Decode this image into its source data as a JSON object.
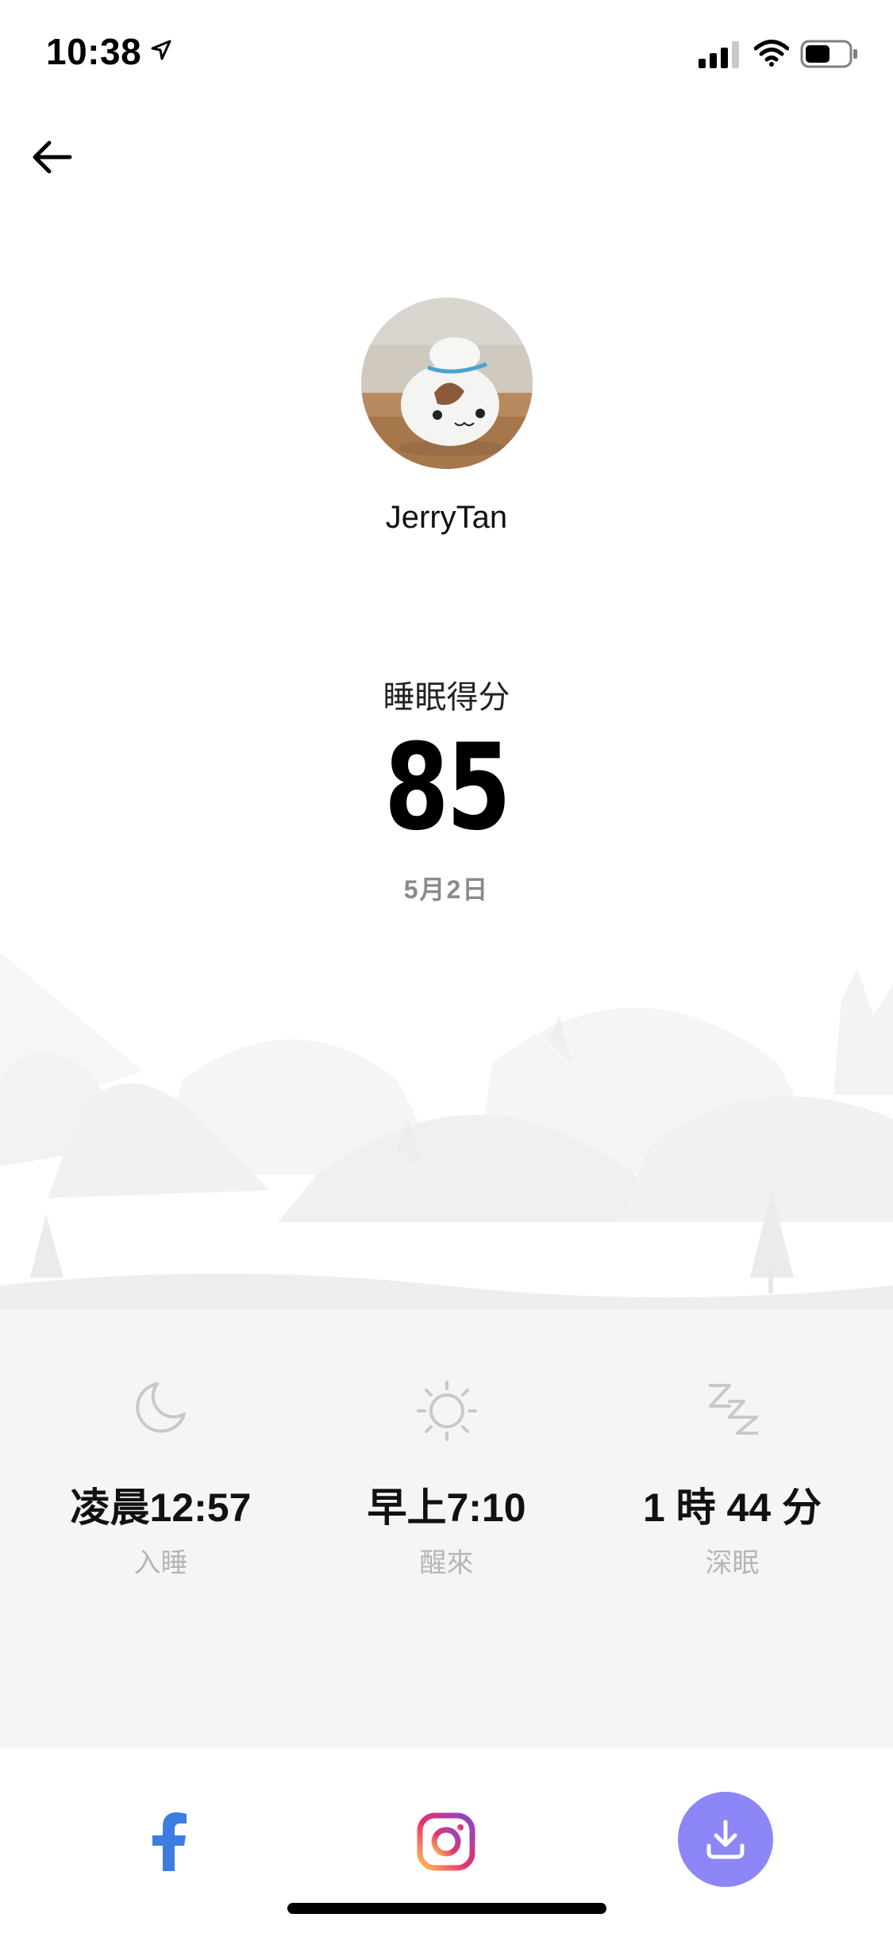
{
  "status_bar": {
    "time": "10:38"
  },
  "profile": {
    "username": "JerryTan"
  },
  "sleep_score": {
    "title": "睡眠得分",
    "value": "85",
    "date": "5月2日"
  },
  "stats": [
    {
      "icon": "moon-icon",
      "value": "凌晨12:57",
      "label": "入睡"
    },
    {
      "icon": "sun-icon",
      "value": "早上7:10",
      "label": "醒來"
    },
    {
      "icon": "zzz-icon",
      "value": "1 時 44 分",
      "label": "深眠"
    }
  ],
  "share": {
    "facebook_icon": "facebook-icon",
    "instagram_icon": "instagram-icon",
    "download_icon": "download-icon"
  },
  "colors": {
    "accent": "#8c86f6",
    "facebook": "#3b7de0",
    "panel_bg": "#f5f5f5",
    "label_gray": "#b6b6b6"
  }
}
